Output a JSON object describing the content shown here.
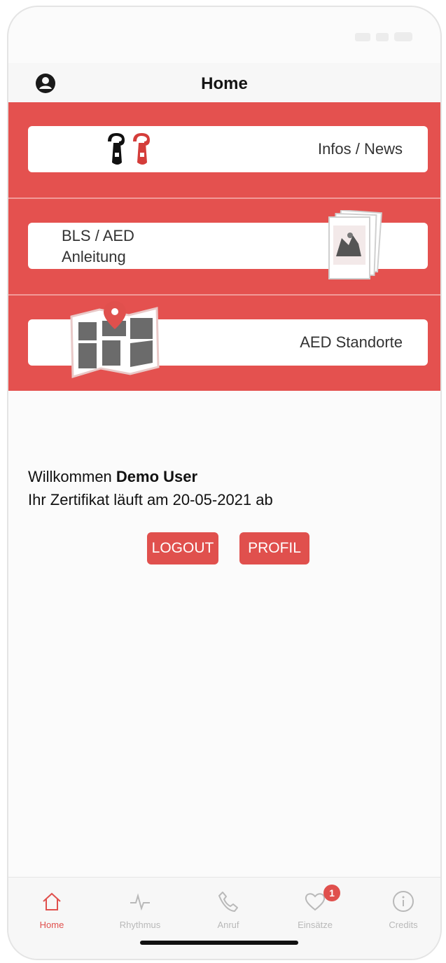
{
  "header": {
    "title": "Home"
  },
  "menu": {
    "infos_label": "Infos / News",
    "bls_line1": "BLS / AED",
    "bls_line2": "Anleitung",
    "aed_label": "AED Standorte"
  },
  "welcome": {
    "greeting": "Willkommen",
    "user_name": "Demo User",
    "certificate_text": "Ihr Zertifikat läuft am 20-05-2021 ab"
  },
  "buttons": {
    "logout": "LOGOUT",
    "profil": "PROFIL"
  },
  "tabs": [
    {
      "label": "Home",
      "icon": "home-icon",
      "active": true
    },
    {
      "label": "Rhythmus",
      "icon": "pulse-icon",
      "active": false
    },
    {
      "label": "Anruf",
      "icon": "phone-icon",
      "active": false
    },
    {
      "label": "Einsätze",
      "icon": "heart-icon",
      "active": false,
      "badge": "1"
    },
    {
      "label": "Credits",
      "icon": "info-icon",
      "active": false
    }
  ],
  "colors": {
    "accent": "#e4514f",
    "tab_inactive": "#b9b9b9"
  }
}
